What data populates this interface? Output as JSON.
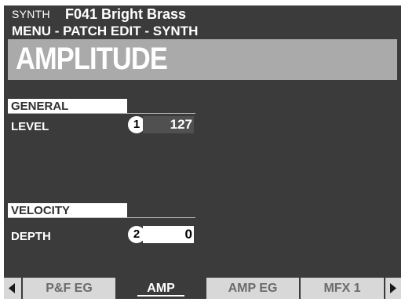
{
  "header": {
    "mode": "SYNTH",
    "patch_name": "F041 Bright Brass",
    "menu_path": "MENU - PATCH EDIT - SYNTH"
  },
  "page_title": "AMPLITUDE",
  "sections": {
    "general": {
      "label": "GENERAL",
      "param_label": "LEVEL",
      "marker": "1",
      "value": "127"
    },
    "velocity": {
      "label": "VELOCITY",
      "param_label": "DEPTH",
      "marker": "2",
      "value": "0"
    }
  },
  "tabs": [
    {
      "label": "P&F EG",
      "active": false
    },
    {
      "label": "AMP",
      "active": true
    },
    {
      "label": "AMP EG",
      "active": false
    },
    {
      "label": "MFX 1",
      "active": false
    }
  ],
  "nav": {
    "prev_icon": "left-triangle-icon",
    "next_icon": "right-triangle-icon"
  },
  "colors": {
    "screen_bg": "#3b3b3b",
    "title_bar": "#aaaaaa",
    "tab_bg": "#d8d8d8"
  }
}
